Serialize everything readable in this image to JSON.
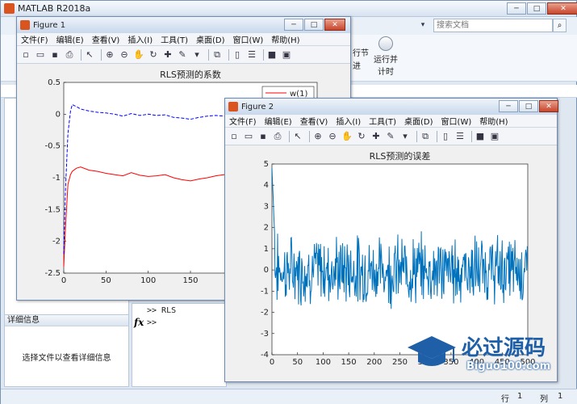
{
  "app": {
    "title": "MATLAB R2018a"
  },
  "search": {
    "placeholder": "搜索文档"
  },
  "ribbon": {
    "run_section_label": "行节",
    "advance_label": "进",
    "run_and_time_line1": "运行并",
    "run_and_time_line2": "计时"
  },
  "detail_panel": {
    "header": "详细信息",
    "body": "选择文件以查看详细信息"
  },
  "command_window": {
    "line1": ">> RLS",
    "line2": ">>",
    "fx": "fx"
  },
  "status_bar": {
    "row_label": "行",
    "row_value": "1",
    "col_label": "列",
    "col_value": "1"
  },
  "menu_items": [
    "文件(F)",
    "编辑(E)",
    "查看(V)",
    "插入(I)",
    "工具(T)",
    "桌面(D)",
    "窗口(W)",
    "帮助(H)"
  ],
  "figure1": {
    "title": "Figure 1",
    "legend": "w(1)",
    "chart_data": {
      "type": "line",
      "title": "RLS预测的系数",
      "xlim": [
        0,
        300
      ],
      "ylim": [
        -2.5,
        0.5
      ],
      "xticks": [
        0,
        50,
        100,
        150,
        200,
        250,
        300
      ],
      "yticks": [
        0.5,
        0,
        -0.5,
        -1,
        -1.5,
        -2,
        -2.5
      ],
      "series": [
        {
          "name": "w(1)",
          "color": "#ff0000",
          "style": "solid",
          "x": [
            0,
            2,
            5,
            8,
            10,
            15,
            20,
            30,
            40,
            50,
            60,
            70,
            80,
            90,
            100,
            110,
            120,
            130,
            140,
            150,
            160,
            170,
            180,
            190,
            200,
            210,
            220,
            230,
            240,
            250,
            255,
            260,
            270,
            280,
            290,
            300
          ],
          "y": [
            -2.4,
            -1.8,
            -1.1,
            -0.95,
            -0.9,
            -0.85,
            -0.83,
            -0.88,
            -0.9,
            -0.93,
            -0.95,
            -0.97,
            -0.92,
            -0.96,
            -0.98,
            -0.97,
            -0.95,
            -1.0,
            -1.03,
            -1.05,
            -1.02,
            -1.0,
            -0.97,
            -0.95,
            -0.97,
            -0.93,
            -0.95,
            -0.92,
            -0.93,
            -0.93,
            -1.15,
            -1.13,
            -1.1,
            -1.05,
            -1.03,
            -1.0
          ]
        },
        {
          "name": "",
          "color": "#0000ff",
          "style": "dashed",
          "x": [
            0,
            2,
            5,
            8,
            10,
            15,
            20,
            30,
            40,
            50,
            60,
            70,
            80,
            90,
            100,
            110,
            120,
            130,
            140,
            150,
            160,
            170,
            180,
            190,
            200,
            210,
            220,
            230,
            240,
            250,
            255,
            260,
            270,
            280,
            290,
            300
          ],
          "y": [
            -2.2,
            -1.2,
            -0.3,
            0.05,
            0.15,
            0.12,
            0.08,
            0.05,
            0.03,
            0.02,
            0.0,
            -0.03,
            0.01,
            -0.02,
            0.0,
            -0.02,
            -0.01,
            -0.05,
            -0.06,
            -0.08,
            -0.05,
            -0.03,
            -0.02,
            -0.03,
            -0.05,
            -0.02,
            0.0,
            -0.03,
            -0.04,
            -0.04,
            -0.18,
            -0.16,
            -0.12,
            -0.1,
            -0.06,
            -0.05
          ]
        }
      ]
    }
  },
  "figure2": {
    "title": "Figure 2",
    "chart_data": {
      "type": "line",
      "title": "RLS预测的误差",
      "xlim": [
        0,
        500
      ],
      "ylim": [
        -4,
        5
      ],
      "xticks": [
        0,
        50,
        100,
        150,
        200,
        250,
        300,
        350,
        400,
        450,
        500
      ],
      "yticks": [
        5,
        4,
        3,
        2,
        1,
        0,
        -1,
        -2,
        -3,
        -4
      ],
      "series": [
        {
          "name": "",
          "color": "#0072bd",
          "style": "solid",
          "seed": 7,
          "n": 500,
          "amplitude": 1.2,
          "start_y": 4.8
        }
      ]
    }
  }
}
